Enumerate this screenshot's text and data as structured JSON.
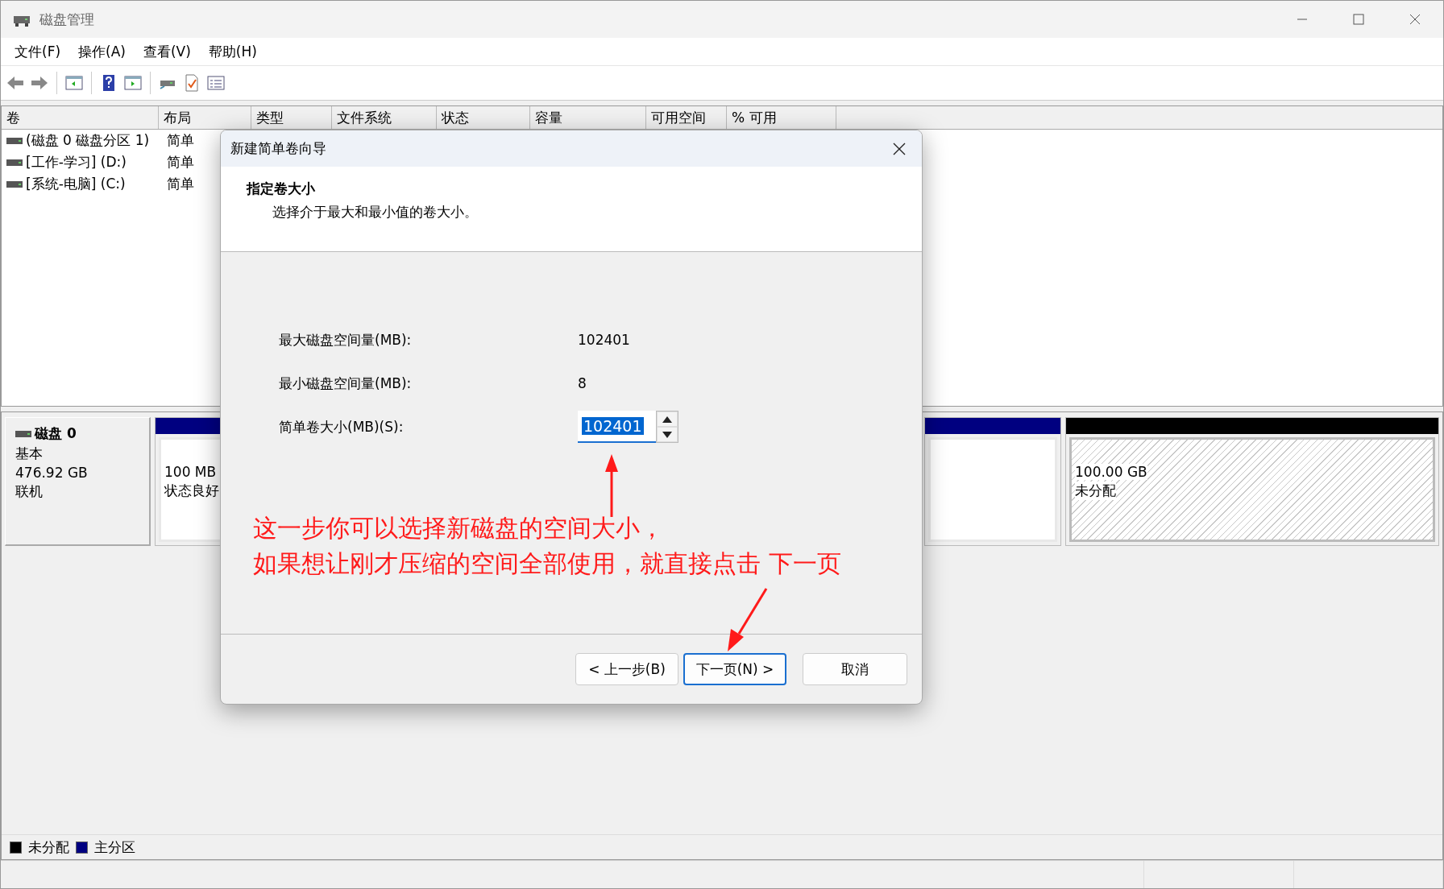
{
  "window": {
    "title": "磁盘管理"
  },
  "menu": [
    "文件(F)",
    "操作(A)",
    "查看(V)",
    "帮助(H)"
  ],
  "columns": [
    "卷",
    "布局",
    "类型",
    "文件系统",
    "状态",
    "容量",
    "可用空间",
    "% 可用"
  ],
  "volumes": [
    {
      "name": "(磁盘 0 磁盘分区 1)",
      "layout": "简单"
    },
    {
      "name": "[工作-学习] (D:)",
      "layout": "简单"
    },
    {
      "name": "[系统-电脑] (C:)",
      "layout": "简单"
    }
  ],
  "disk": {
    "name": "磁盘 0",
    "type": "基本",
    "size": "476.92 GB",
    "status": "联机"
  },
  "partitions": [
    {
      "kind": "primary",
      "size": "100 MB",
      "status": "状态良好"
    },
    {
      "kind": "primary"
    },
    {
      "kind": "unallocated",
      "size": "100.00 GB",
      "status": "未分配"
    }
  ],
  "legend": [
    {
      "label": "未分配",
      "color": "#000000"
    },
    {
      "label": "主分区",
      "color": "#000080"
    }
  ],
  "dialog": {
    "title": "新建简单卷向导",
    "heading": "指定卷大小",
    "subheading": "选择介于最大和最小值的卷大小。",
    "fields": [
      {
        "kind": "info",
        "label": "最大磁盘空间量(MB):",
        "value": "102401"
      },
      {
        "kind": "info",
        "label": "最小磁盘空间量(MB):",
        "value": "8"
      },
      {
        "kind": "spin",
        "label": "简单卷大小(MB)(S):",
        "value": "102401",
        "text_selected": true
      }
    ],
    "buttons": [
      {
        "label": "< 上一步(B)",
        "focused": false
      },
      {
        "label": "下一页(N) >",
        "focused": true
      },
      {
        "label": "取消",
        "focused": false
      }
    ]
  },
  "annotation": {
    "lines": [
      "这一步你可以选择新磁盘的空间大小，",
      "如果想让刚才压缩的空间全部使用，就直接点击 下一页"
    ]
  }
}
